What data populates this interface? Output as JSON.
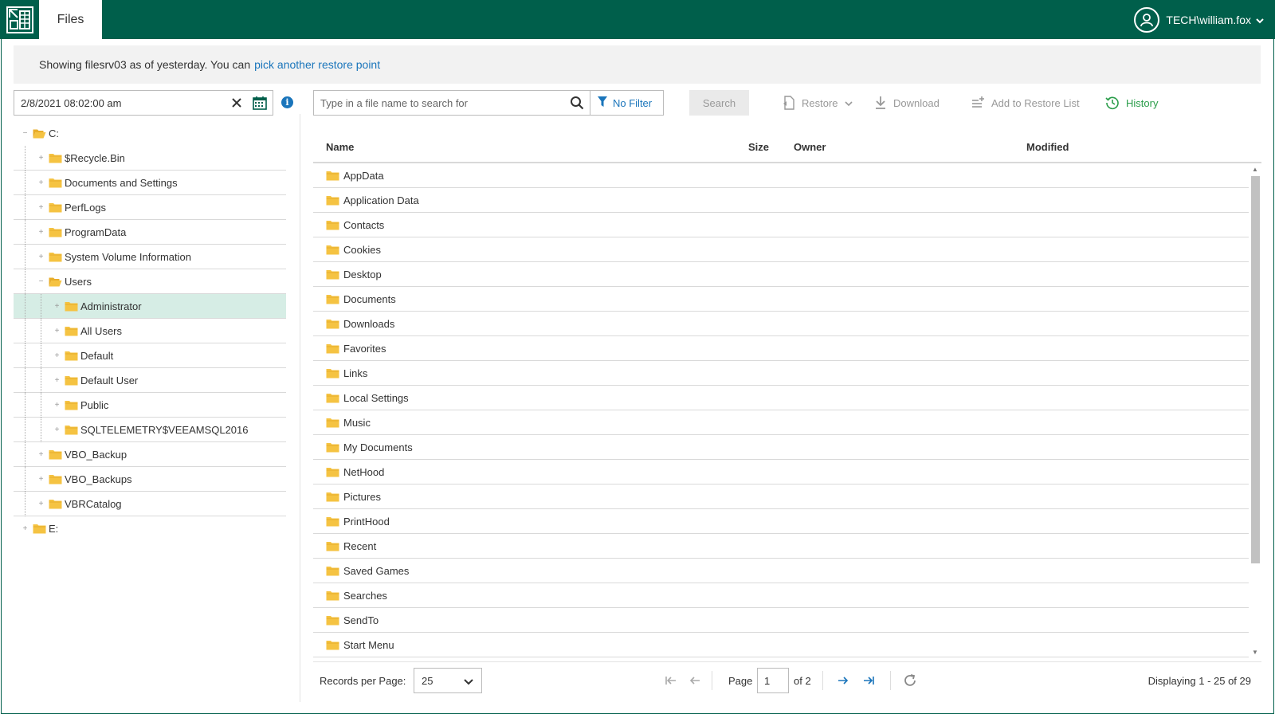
{
  "colors": {
    "brand": "#005f4b",
    "link": "#1a75bb",
    "history": "#2a9d4a",
    "selected_row": "#d6ede5",
    "folder": "#f5c342"
  },
  "header": {
    "logo_icon": "veeam-logo-icon",
    "active_tab": "Files",
    "user": "TECH\\william.fox"
  },
  "notice": {
    "text": "Showing filesrv03 as of yesterday. You can",
    "link": "pick another restore point"
  },
  "restore_point": {
    "value": "2/8/2021 08:02:00 am"
  },
  "tree": [
    {
      "label": "C:",
      "level": 0,
      "expanded": true
    },
    {
      "label": "$Recycle.Bin",
      "level": 1,
      "expanded": false
    },
    {
      "label": "Documents and Settings",
      "level": 1,
      "expanded": false
    },
    {
      "label": "PerfLogs",
      "level": 1,
      "expanded": false
    },
    {
      "label": "ProgramData",
      "level": 1,
      "expanded": false
    },
    {
      "label": "System Volume Information",
      "level": 1,
      "expanded": false
    },
    {
      "label": "Users",
      "level": 1,
      "expanded": true
    },
    {
      "label": "Administrator",
      "level": 2,
      "expanded": false,
      "selected": true
    },
    {
      "label": "All Users",
      "level": 2,
      "expanded": false
    },
    {
      "label": "Default",
      "level": 2,
      "expanded": false
    },
    {
      "label": "Default User",
      "level": 2,
      "expanded": false
    },
    {
      "label": "Public",
      "level": 2,
      "expanded": false
    },
    {
      "label": "SQLTELEMETRY$VEEAMSQL2016",
      "level": 2,
      "expanded": false
    },
    {
      "label": "VBO_Backup",
      "level": 1,
      "expanded": false
    },
    {
      "label": "VBO_Backups",
      "level": 1,
      "expanded": false
    },
    {
      "label": "VBRCatalog",
      "level": 1,
      "expanded": false
    },
    {
      "label": "E:",
      "level": 0,
      "expanded": false
    }
  ],
  "toolbar": {
    "search_placeholder": "Type in a file name to search for",
    "filter_label": "No Filter",
    "search_button": "Search",
    "restore_label": "Restore",
    "download_label": "Download",
    "add_restore_list_label": "Add to Restore List",
    "history_label": "History"
  },
  "grid": {
    "columns": {
      "name": "Name",
      "size": "Size",
      "owner": "Owner",
      "modified": "Modified"
    },
    "rows": [
      "AppData",
      "Application Data",
      "Contacts",
      "Cookies",
      "Desktop",
      "Documents",
      "Downloads",
      "Favorites",
      "Links",
      "Local Settings",
      "Music",
      "My Documents",
      "NetHood",
      "Pictures",
      "PrintHood",
      "Recent",
      "Saved Games",
      "Searches",
      "SendTo",
      "Start Menu"
    ]
  },
  "footer": {
    "records_per_page_label": "Records per Page:",
    "records_per_page_value": "25",
    "page_label": "Page",
    "page_value": "1",
    "page_of": "of 2",
    "displaying": "Displaying 1 - 25 of 29"
  }
}
